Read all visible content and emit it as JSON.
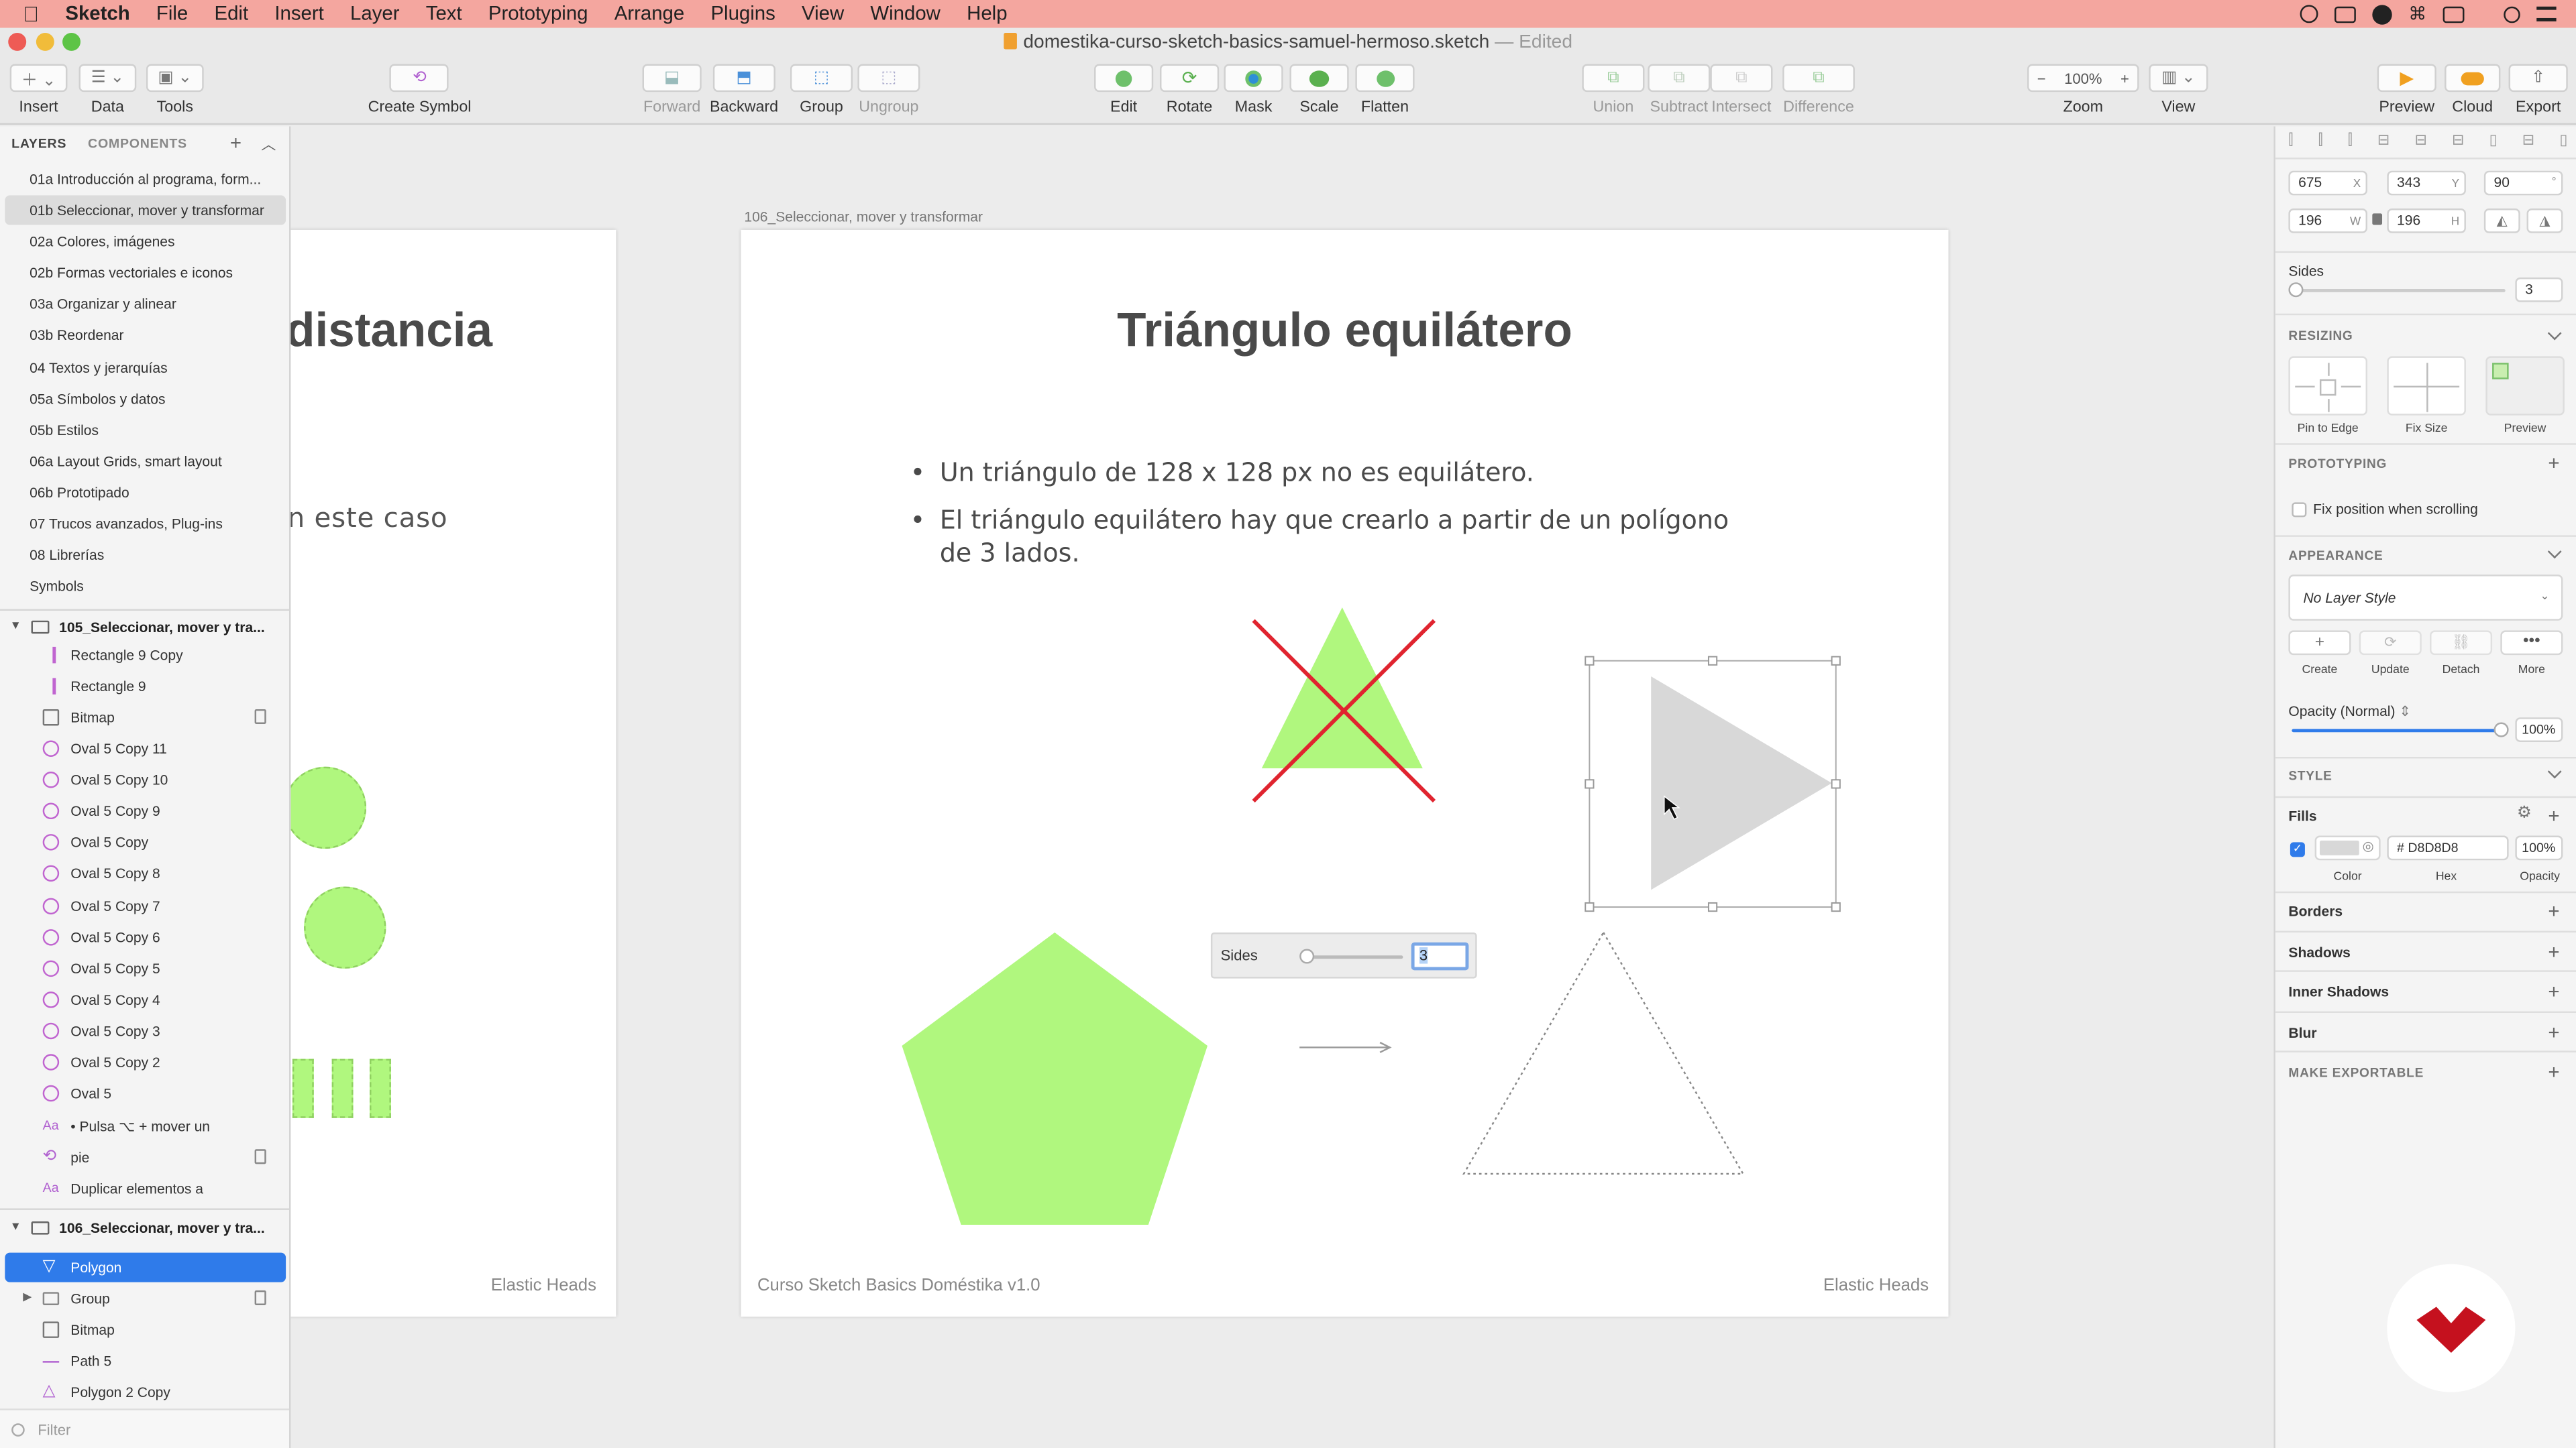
{
  "menubar": {
    "app": "Sketch",
    "items": [
      "File",
      "Edit",
      "Insert",
      "Layer",
      "Text",
      "Prototyping",
      "Arrange",
      "Plugins",
      "View",
      "Window",
      "Help"
    ]
  },
  "window": {
    "title": "domestika-curso-sketch-basics-samuel-hermoso.sketch",
    "status": "— Edited"
  },
  "toolbar": {
    "insert": "Insert",
    "data": "Data",
    "tools": "Tools",
    "create_symbol": "Create Symbol",
    "forward": "Forward",
    "backward": "Backward",
    "group": "Group",
    "ungroup": "Ungroup",
    "edit": "Edit",
    "rotate": "Rotate",
    "mask": "Mask",
    "scale": "Scale",
    "flatten": "Flatten",
    "union": "Union",
    "subtract": "Subtract",
    "intersect": "Intersect",
    "difference": "Difference",
    "zoom_value": "100%",
    "zoom": "Zoom",
    "view": "View",
    "preview": "Preview",
    "cloud": "Cloud",
    "export": "Export"
  },
  "left_panel": {
    "tab_layers": "LAYERS",
    "tab_components": "COMPONENTS",
    "pages": [
      "01a Introducción al programa, form...",
      "01b Seleccionar, mover y transformar",
      "02a Colores, imágenes",
      "02b Formas vectoriales e iconos",
      "03a Organizar y alinear",
      "03b Reordenar",
      "04 Textos y jerarquías",
      "05a Símbolos y datos",
      "05b Estilos",
      "06a Layout Grids, smart layout",
      "06b Prototipado",
      "07 Trucos avanzados, Plug-ins",
      "08 Librerías",
      "Symbols"
    ],
    "artboard1": "105_Seleccionar, mover y tra...",
    "layers1": [
      "Rectangle 9 Copy",
      "Rectangle 9",
      "Bitmap",
      "Oval 5 Copy 11",
      "Oval 5 Copy 10",
      "Oval 5 Copy 9",
      "Oval 5 Copy",
      "Oval 5 Copy 8",
      "Oval 5 Copy 7",
      "Oval 5 Copy 6",
      "Oval 5 Copy 5",
      "Oval 5 Copy 4",
      "Oval 5 Copy 3",
      "Oval 5 Copy 2",
      "Oval 5",
      "• Pulsa ⌥ + mover un",
      "pie",
      "Duplicar elementos a"
    ],
    "artboard2": "106_Seleccionar, mover y tra...",
    "layers2": [
      "Polygon",
      "Group",
      "Bitmap",
      "Path 5",
      "Polygon 2 Copy"
    ],
    "filter": "Filter"
  },
  "canvas": {
    "left_board_title": "distancia",
    "left_board_text": "n este caso",
    "left_board_footer": "Elastic Heads",
    "artboard_label": "106_Seleccionar, mover y transformar",
    "title": "Triángulo equilátero",
    "bullet1": "Un triángulo de 128 x 128 px no es equilátero.",
    "bullet2a": "El triángulo equilátero hay que crearlo a partir de un polígono",
    "bullet2b": "de 3 lados.",
    "sides_popup_label": "Sides",
    "sides_popup_value": "3",
    "footer_left": "Curso Sketch Basics Doméstika v1.0",
    "footer_right": "Elastic Heads",
    "colors": {
      "green": "#b0f77e",
      "red": "#e0242f",
      "gray": "#d8d8d8"
    }
  },
  "right_panel": {
    "x": "675",
    "x_label": "X",
    "y": "343",
    "y_label": "Y",
    "rotation": "90",
    "rotation_unit": "°",
    "w": "196",
    "w_label": "W",
    "h": "196",
    "h_label": "H",
    "sides_label": "Sides",
    "sides_value": "3",
    "resizing": "RESIZING",
    "pin_to_edge": "Pin to Edge",
    "fix_size": "Fix Size",
    "preview": "Preview",
    "prototyping": "PROTOTYPING",
    "fix_position": "Fix position when scrolling",
    "appearance": "APPEARANCE",
    "layer_style": "No Layer Style",
    "create": "Create",
    "update": "Update",
    "detach": "Detach",
    "more": "More",
    "opacity_label": "Opacity (Normal)",
    "opacity_value": "100%",
    "style": "STYLE",
    "fills": "Fills",
    "fill_hex": "# D8D8D8",
    "fill_opacity": "100%",
    "color_label": "Color",
    "hex_label": "Hex",
    "opacity_col_label": "Opacity",
    "borders": "Borders",
    "shadows": "Shadows",
    "inner_shadows": "Inner Shadows",
    "blur": "Blur",
    "make_exportable": "MAKE EXPORTABLE",
    "fill_color": "#d8d8d8"
  }
}
